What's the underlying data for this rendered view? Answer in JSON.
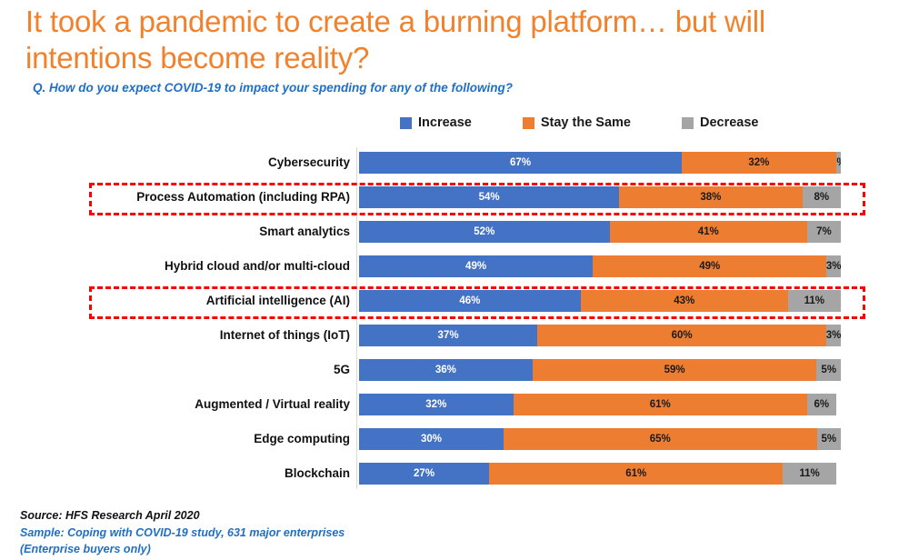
{
  "title": "It took a pandemic to create a burning platform… but will intentions become reality?",
  "subtitle": "Q. How do you expect COVID-19 to impact your spending for any of the following?",
  "colors": {
    "title": "#F0822E",
    "subtitle": "#1F6FC4",
    "increase": "#4472C4",
    "stay_the_same": "#ED7D31",
    "decrease": "#A5A5A5",
    "highlight": "#FF0000"
  },
  "legend": {
    "position": "top",
    "items": [
      {
        "label": "Increase",
        "color": "#4472C4",
        "icon": "square-swatch-icon"
      },
      {
        "label": "Stay the Same",
        "color": "#ED7D31",
        "icon": "square-swatch-icon"
      },
      {
        "label": "Decrease",
        "color": "#A5A5A5",
        "icon": "square-swatch-icon"
      }
    ]
  },
  "chart_data": {
    "type": "bar",
    "orientation": "horizontal",
    "stacked": true,
    "stacked_percent": true,
    "title": "It took a pandemic to create a burning platform… but will intentions become reality?",
    "subtitle": "Q. How do you expect COVID-19 to impact your spending for any of the following?",
    "xlabel": "",
    "ylabel": "",
    "xlim": [
      0,
      100
    ],
    "grid": false,
    "legend_position": "top",
    "categories": [
      "Cybersecurity",
      "Process Automation (including RPA)",
      "Smart analytics",
      "Hybrid cloud and/or multi-cloud",
      "Artificial intelligence (AI)",
      "Internet of things (IoT)",
      "5G",
      "Augmented / Virtual reality",
      "Edge computing",
      "Blockchain"
    ],
    "series": [
      {
        "name": "Increase",
        "color": "#4472C4",
        "values": [
          67,
          54,
          52,
          49,
          46,
          37,
          36,
          32,
          30,
          27
        ]
      },
      {
        "name": "Stay the Same",
        "color": "#ED7D31",
        "values": [
          32,
          38,
          41,
          49,
          43,
          60,
          59,
          61,
          65,
          61
        ]
      },
      {
        "name": "Decrease",
        "color": "#A5A5A5",
        "values": [
          1,
          8,
          7,
          3,
          11,
          3,
          5,
          6,
          5,
          11
        ]
      }
    ],
    "data_labels": [
      {
        "category": "Cybersecurity",
        "increase": "67%",
        "stay_the_same": "32%",
        "decrease": "1%"
      },
      {
        "category": "Process Automation (including RPA)",
        "increase": "54%",
        "stay_the_same": "38%",
        "decrease": "8%"
      },
      {
        "category": "Smart analytics",
        "increase": "52%",
        "stay_the_same": "41%",
        "decrease": "7%"
      },
      {
        "category": "Hybrid cloud and/or multi-cloud",
        "increase": "49%",
        "stay_the_same": "49%",
        "decrease": "3%"
      },
      {
        "category": "Artificial intelligence (AI)",
        "increase": "46%",
        "stay_the_same": "43%",
        "decrease": "11%"
      },
      {
        "category": "Internet of things (IoT)",
        "increase": "37%",
        "stay_the_same": "60%",
        "decrease": "3%"
      },
      {
        "category": "5G",
        "increase": "36%",
        "stay_the_same": "59%",
        "decrease": "5%"
      },
      {
        "category": "Augmented / Virtual reality",
        "increase": "32%",
        "stay_the_same": "61%",
        "decrease": "6%"
      },
      {
        "category": "Edge computing",
        "increase": "30%",
        "stay_the_same": "65%",
        "decrease": "5%"
      },
      {
        "category": "Blockchain",
        "increase": "27%",
        "stay_the_same": "61%",
        "decrease": "11%"
      }
    ],
    "annotations": [
      {
        "type": "dashed-rectangle",
        "color": "#FF0000",
        "highlights": "Process Automation (including RPA)"
      },
      {
        "type": "dashed-rectangle",
        "color": "#FF0000",
        "highlights": "Artificial intelligence (AI)"
      }
    ]
  },
  "footer": {
    "source": "Source: HFS Research April 2020",
    "sample_line1": "Sample: Coping with COVID-19 study, 631 major enterprises",
    "sample_line2": "(Enterprise buyers only)"
  }
}
